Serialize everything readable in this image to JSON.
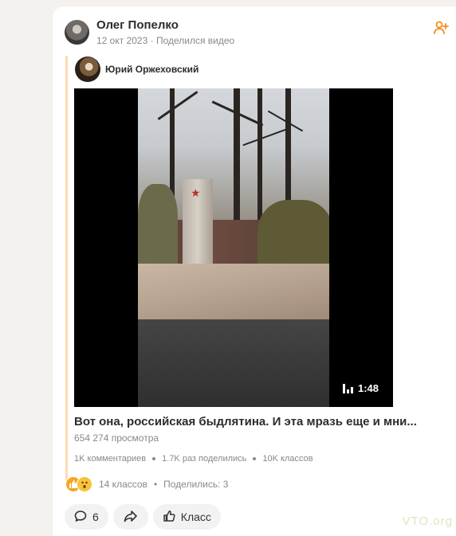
{
  "post": {
    "author": "Олег Попелко",
    "date": "12 окт 2023",
    "meta_sep": "·",
    "action": "Поделился видео"
  },
  "original": {
    "author": "Юрий Оржеховский"
  },
  "video": {
    "duration": "1:48",
    "title": "Вот она, российская быдлятина. И эта мразь еще и мни...",
    "views": "654 274 просмотра",
    "stats": {
      "comments": "1K комментариев",
      "shares": "1.7K раз поделились",
      "likes": "10K классов"
    }
  },
  "reactions": {
    "classes": "14 классов",
    "sep": "•",
    "shares": "Поделились: 3"
  },
  "actions": {
    "comments_count": "6",
    "like_label": "Класс"
  },
  "watermark": "VTO.org",
  "colors": {
    "accent": "#f28b1e",
    "repost_bar": "#ffd8b0",
    "background": "#f4f1ee"
  }
}
